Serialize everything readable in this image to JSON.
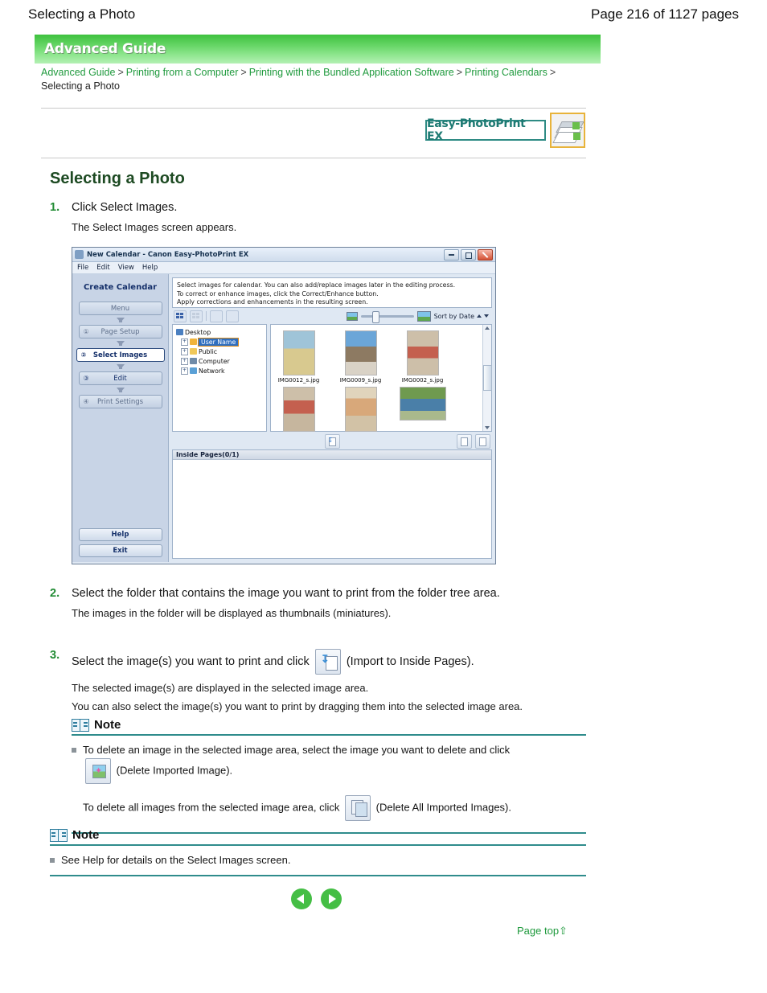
{
  "header": {
    "doc_title": "Selecting a Photo",
    "page_count": "Page 216 of 1127 pages"
  },
  "banner": {
    "title": "Advanced Guide"
  },
  "breadcrumb": {
    "items": [
      "Advanced Guide",
      "Printing from a Computer",
      "Printing with the Bundled Application Software",
      "Printing Calendars"
    ],
    "separator": ">",
    "current": "Selecting a Photo"
  },
  "product_logo": {
    "label": "Easy-PhotoPrint EX",
    "icon": "stacked-photos-icon"
  },
  "page_title": "Selecting a Photo",
  "steps": [
    {
      "number": "1.",
      "text": "Click Select Images.",
      "sub": [
        "The Select Images screen appears."
      ]
    },
    {
      "number": "2.",
      "text": "Select the folder that contains the image you want to print from the folder tree area.",
      "sub": [
        "The images in the folder will be displayed as thumbnails (miniatures)."
      ]
    },
    {
      "number": "3.",
      "text_before": "Select the image(s) you want to print and click",
      "text_after": "(Import to Inside Pages).",
      "icon": "import-to-inside-pages-icon",
      "sub": [
        "The selected image(s) are displayed in the selected image area.",
        "You can also select the image(s) you want to print by dragging them into the selected image area."
      ]
    }
  ],
  "app_window": {
    "title": "New Calendar - Canon Easy-PhotoPrint EX",
    "window_buttons": [
      "minimize",
      "maximize",
      "close"
    ],
    "menus": [
      "File",
      "Edit",
      "View",
      "Help"
    ],
    "sidebar": {
      "heading": "Create Calendar",
      "items": [
        {
          "num": "",
          "label": "Menu",
          "state": "disabled"
        },
        {
          "num": "①",
          "label": "Page Setup",
          "state": "disabled"
        },
        {
          "num": "②",
          "label": "Select Images",
          "state": "active"
        },
        {
          "num": "③",
          "label": "Edit",
          "state": "enabled"
        },
        {
          "num": "④",
          "label": "Print Settings",
          "state": "disabled"
        }
      ],
      "bottom_buttons": [
        "Help",
        "Exit"
      ]
    },
    "description": [
      "Select images for calendar. You can also add/replace images later in the editing process.",
      "To correct or enhance images, click the Correct/Enhance button.",
      "Apply corrections and enhancements in the resulting screen."
    ],
    "toolbar": {
      "icons": [
        "grid-view-icon",
        "grid-view-off-icon",
        "correct-enhance-icon",
        "special-filter-icon"
      ],
      "zoom_small_icon": "small-thumbnail-icon",
      "zoom_large_icon": "large-thumbnail-icon",
      "sort_label": "Sort by Date"
    },
    "folder_tree": [
      {
        "label": "Desktop",
        "icon": "desktop-icon",
        "level": 0,
        "selected": false,
        "expander": false
      },
      {
        "label": "User Name",
        "icon": "user-folder-icon",
        "level": 1,
        "selected": true,
        "expander": true
      },
      {
        "label": "Public",
        "icon": "public-folder-icon",
        "level": 1,
        "selected": false,
        "expander": true
      },
      {
        "label": "Computer",
        "icon": "computer-icon",
        "level": 1,
        "selected": false,
        "expander": true
      },
      {
        "label": "Network",
        "icon": "network-icon",
        "level": 1,
        "selected": false,
        "expander": true
      }
    ],
    "thumbnails": [
      {
        "name": "IMG0012_s.jpg",
        "orientation": "portrait"
      },
      {
        "name": "IMG0009_s.jpg",
        "orientation": "portrait"
      },
      {
        "name": "IMG0002_s.jpg",
        "orientation": "portrait"
      },
      {
        "name": "",
        "orientation": "portrait"
      },
      {
        "name": "",
        "orientation": "portrait"
      },
      {
        "name": "",
        "orientation": "landscape"
      }
    ],
    "mid_toolbar": {
      "import_icon": "import-to-inside-pages-icon",
      "delete_icon": "delete-imported-image-icon",
      "delete_all_icon": "delete-all-imported-images-icon"
    },
    "selected_area_header": "Inside Pages(0/1)"
  },
  "notes": [
    {
      "title": "Note",
      "icon": "note-book-icon",
      "items": [
        {
          "text_before": "To delete an image in the selected image area, select the image you want to delete and click",
          "icon": "delete-imported-image-icon",
          "text_after": "(Delete Imported Image)."
        },
        {
          "text_before": "To delete all images from the selected image area, click",
          "icon": "delete-all-imported-images-icon",
          "text_after": "(Delete All Imported Images)."
        }
      ]
    },
    {
      "title": "Note",
      "icon": "note-book-icon",
      "items": [
        {
          "text_before": "See Help for details on the Select Images screen.",
          "icon": null,
          "text_after": ""
        }
      ]
    }
  ],
  "footer": {
    "prev_label": "previous-page-arrow",
    "next_label": "next-page-arrow",
    "page_top": "Page top⇧"
  },
  "colors": {
    "accent_green": "#1f9a3d",
    "banner_green": "#63d463",
    "title_green": "#1d4a22",
    "teal_rule": "#2f8c8c",
    "logo_teal": "#1d7a73"
  }
}
